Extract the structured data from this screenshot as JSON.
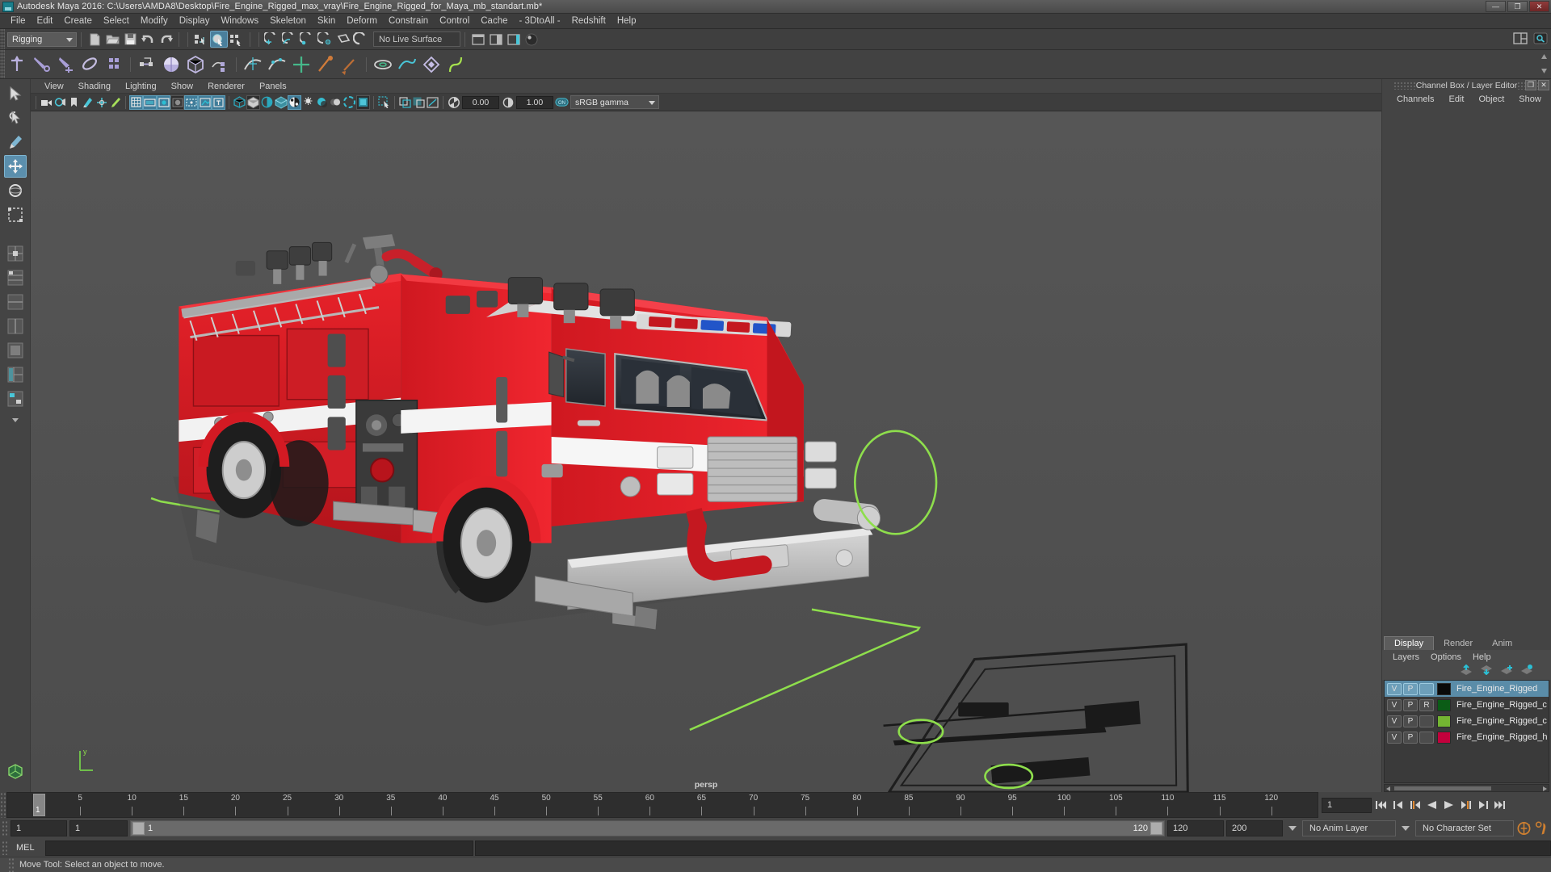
{
  "window": {
    "title": "Autodesk Maya 2016: C:\\Users\\AMDA8\\Desktop\\Fire_Engine_Rigged_max_vray\\Fire_Engine_Rigged_for_Maya_mb_standart.mb*",
    "minimize": "—",
    "maximize": "❐",
    "close": "✕"
  },
  "menubar": {
    "items": [
      {
        "label": "File"
      },
      {
        "label": "Edit"
      },
      {
        "label": "Create"
      },
      {
        "label": "Select"
      },
      {
        "label": "Modify"
      },
      {
        "label": "Display"
      },
      {
        "label": "Windows"
      },
      {
        "label": "Skeleton"
      },
      {
        "label": "Skin"
      },
      {
        "label": "Deform"
      },
      {
        "label": "Constrain"
      },
      {
        "label": "Control"
      },
      {
        "label": "Cache"
      },
      {
        "label": "- 3DtoAll -"
      },
      {
        "label": "Redshift"
      },
      {
        "label": "Help"
      }
    ]
  },
  "statusline": {
    "menu_set": "Rigging",
    "live_surface": "No Live Surface"
  },
  "viewport_menu": {
    "items": [
      {
        "label": "View"
      },
      {
        "label": "Shading"
      },
      {
        "label": "Lighting"
      },
      {
        "label": "Show"
      },
      {
        "label": "Renderer"
      },
      {
        "label": "Panels"
      }
    ]
  },
  "viewport_toolbar": {
    "exposure_value": "0.00",
    "gamma_value": "1.00",
    "color_mgmt_toggle": "ON",
    "color_profile": "sRGB gamma"
  },
  "viewport": {
    "camera_label": "persp",
    "axis_label": "y",
    "model": "fire-engine-rigged"
  },
  "channel_box": {
    "panel_title": "Channel Box / Layer Editor",
    "menu": [
      {
        "label": "Channels"
      },
      {
        "label": "Edit"
      },
      {
        "label": "Object"
      },
      {
        "label": "Show"
      }
    ],
    "restore_glyph": "❐",
    "close_glyph": "✕"
  },
  "layer_editor": {
    "tabs": [
      {
        "label": "Display",
        "active": true
      },
      {
        "label": "Render",
        "active": false
      },
      {
        "label": "Anim",
        "active": false
      }
    ],
    "menu": [
      {
        "label": "Layers"
      },
      {
        "label": "Options"
      },
      {
        "label": "Help"
      }
    ],
    "layers": [
      {
        "v": "V",
        "p": "P",
        "r": "",
        "color": "#0a0a0a",
        "name": "Fire_Engine_Rigged",
        "selected": true
      },
      {
        "v": "V",
        "p": "P",
        "r": "R",
        "color": "#0b5c16",
        "name": "Fire_Engine_Rigged_c",
        "selected": false
      },
      {
        "v": "V",
        "p": "P",
        "r": "",
        "color": "#74b532",
        "name": "Fire_Engine_Rigged_c",
        "selected": false
      },
      {
        "v": "V",
        "p": "P",
        "r": "",
        "color": "#c2003c",
        "name": "Fire_Engine_Rigged_h",
        "selected": false
      }
    ]
  },
  "timeline": {
    "tick_labels": [
      "5",
      "10",
      "15",
      "20",
      "25",
      "30",
      "35",
      "40",
      "45",
      "50",
      "55",
      "60",
      "65",
      "70",
      "75",
      "80",
      "85",
      "90",
      "95",
      "100",
      "105",
      "110",
      "115",
      "120"
    ],
    "current_frame": "1",
    "current_frame_field": "1",
    "playback_buttons": [
      {
        "name": "go-to-start"
      },
      {
        "name": "step-back-key"
      },
      {
        "name": "step-back-frame"
      },
      {
        "name": "play-backwards"
      },
      {
        "name": "play-forwards"
      },
      {
        "name": "step-forward-frame"
      },
      {
        "name": "step-forward-key"
      },
      {
        "name": "go-to-end"
      }
    ]
  },
  "range_slider": {
    "anim_start": "1",
    "range_start": "1",
    "slider_start_value": "1",
    "slider_end_value": "120",
    "range_end": "120",
    "anim_end": "200",
    "anim_layer": "No Anim Layer",
    "character_set": "No Character Set"
  },
  "command_line": {
    "language": "MEL",
    "input_value": "",
    "output_value": ""
  },
  "status_bar": {
    "message": "Move Tool: Select an object to move."
  }
}
